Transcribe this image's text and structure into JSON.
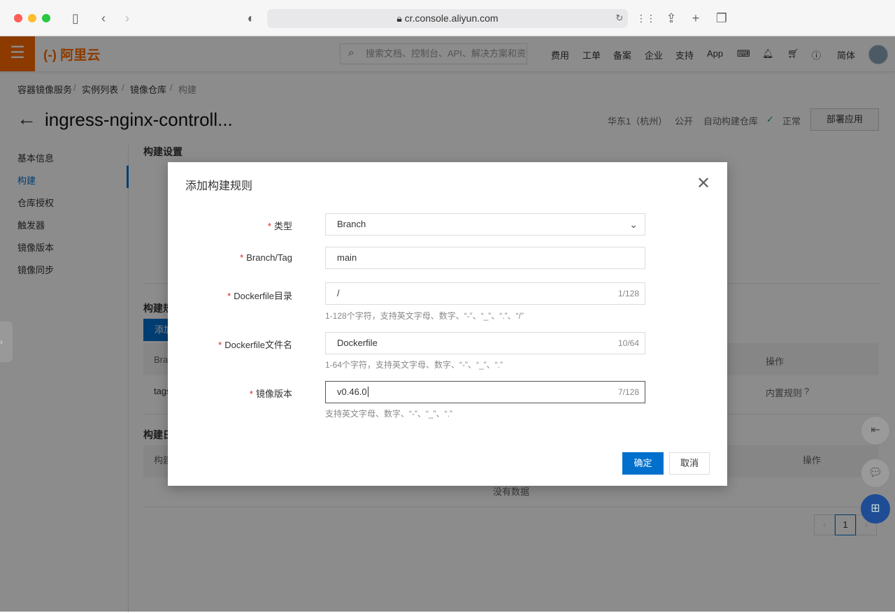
{
  "browser": {
    "url": "cr.console.aliyun.com"
  },
  "header": {
    "logo": "(-) 阿里云",
    "search_placeholder": "搜索文档、控制台、API、解决方案和资源",
    "nav": [
      "费用",
      "工单",
      "备案",
      "企业",
      "支持",
      "App"
    ],
    "lang": "简体",
    "accent": "#ff6a00"
  },
  "breadcrumb": [
    "容器镜像服务",
    "实例列表",
    "镜像仓库",
    "构建"
  ],
  "page": {
    "title": "ingress-nginx-controll...",
    "region": "华东1（杭州）",
    "visibility": "公开",
    "repo_type": "自动构建仓库",
    "status": "正常",
    "deploy_button": "部署应用"
  },
  "sidebar": {
    "items": [
      "基本信息",
      "构建",
      "仓库授权",
      "触发器",
      "镜像版本",
      "镜像同步"
    ],
    "active": 1
  },
  "background": {
    "build_settings": "构建设置",
    "rules_section": "构建规",
    "add_button": "添加",
    "table_col1": "Bra",
    "table_col_action": "操作",
    "row_cell": "tags",
    "row_action": "内置规则",
    "log_section": "构建日",
    "log_col1": "构建",
    "log_col_action": "操作",
    "empty": "没有数据",
    "page": "1"
  },
  "modal": {
    "title": "添加构建规则",
    "fields": [
      {
        "label": "类型",
        "value": "Branch",
        "type": "select"
      },
      {
        "label": "Branch/Tag",
        "value": "main"
      },
      {
        "label": "Dockerfile目录",
        "value": "/",
        "count": "1/128",
        "help": "1-128个字符，支持英文字母、数字、“-”、“_”、“.”、“/”"
      },
      {
        "label": "Dockerfile文件名",
        "value": "Dockerfile",
        "count": "10/64",
        "help": "1-64个字符，支持英文字母、数字、“-”、“_”、“.”"
      },
      {
        "label": "镜像版本",
        "value": "v0.46.0",
        "count": "7/128",
        "help": "支持英文字母、数字、“-”、“_”、“.”"
      }
    ],
    "ok": "确定",
    "cancel": "取消"
  }
}
